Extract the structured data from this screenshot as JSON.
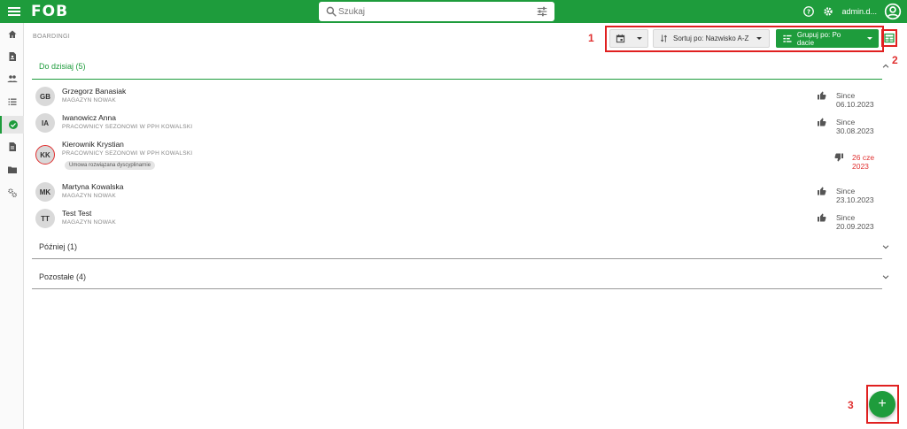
{
  "app": {
    "logo": "FOB"
  },
  "search": {
    "placeholder": "Szukaj"
  },
  "user": {
    "name": "admin.d..."
  },
  "breadcrumb": "BOARDINGI",
  "toolbar": {
    "sort_label": "Sortuj po: Nazwisko A-Z",
    "group_label": "Grupuj po: Po dacie"
  },
  "annotations": {
    "a1": "1",
    "a2": "2",
    "a3": "3"
  },
  "groups": [
    {
      "label": "Do dzisiaj (5)",
      "expanded": true
    },
    {
      "label": "Później (1)",
      "expanded": false
    },
    {
      "label": "Pozostałe (4)",
      "expanded": false
    }
  ],
  "rows": [
    {
      "initials": "GB",
      "name": "Grzegorz Banasiak",
      "org": "MAGAZYN NOWAK",
      "since": "Since 06.10.2023",
      "vote": "up"
    },
    {
      "initials": "IA",
      "name": "Iwanowicz Anna",
      "org": "PRACOWNICY SEZONOWI W PPH KOWALSKI",
      "since": "Since 30.08.2023",
      "vote": "up"
    },
    {
      "initials": "KK",
      "name": "Kierownik Krystian",
      "org": "PRACOWNICY SEZONOWI W PPH KOWALSKI",
      "tag": "Umowa rozwiązana dyscyplinarnie",
      "since": "26 cze 2023",
      "vote": "down"
    },
    {
      "initials": "MK",
      "name": "Martyna Kowalska",
      "org": "MAGAZYN NOWAK",
      "since": "Since 23.10.2023",
      "vote": "up"
    },
    {
      "initials": "TT",
      "name": "Test Test",
      "org": "MAGAZYN NOWAK",
      "since": "Since 20.09.2023",
      "vote": "up"
    }
  ],
  "fab": {
    "label": "+"
  },
  "colors": {
    "brand": "#1e9c3c",
    "annotation": "#e03030"
  }
}
